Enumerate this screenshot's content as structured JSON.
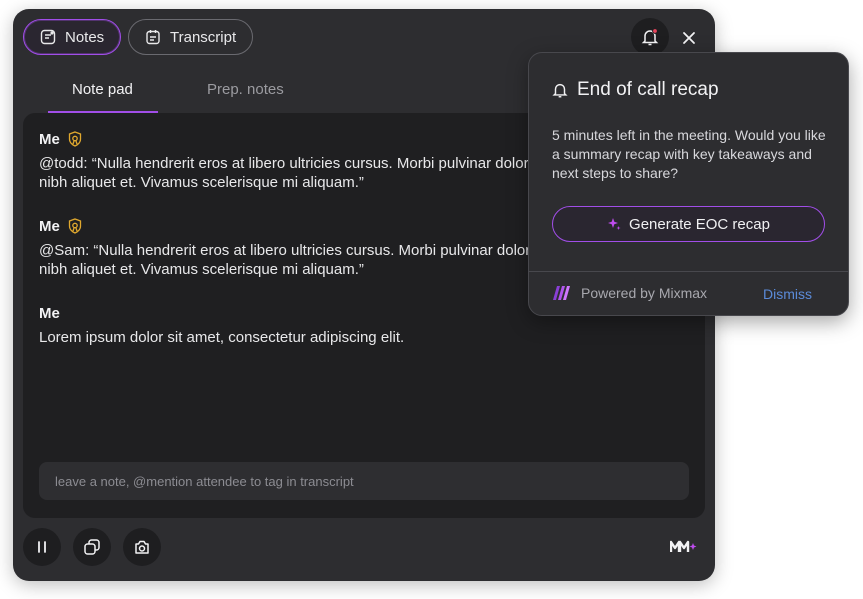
{
  "header": {
    "notes_label": "Notes",
    "transcript_label": "Transcript"
  },
  "tabs": [
    {
      "label": "Note pad",
      "active": true
    },
    {
      "label": "Prep. notes",
      "active": false
    }
  ],
  "notes": [
    {
      "author": "Me",
      "badge": true,
      "lines": [
        "@todd: “Nulla hendrerit eros at libero ultricies cursus. Morbi pulvinar dolor sapien, eu fringilla",
        "nibh aliquet et. Vivamus scelerisque mi aliquam.”"
      ]
    },
    {
      "author": "Me",
      "badge": true,
      "lines": [
        "@Sam: “Nulla hendrerit eros at libero ultricies cursus. Morbi pulvinar dolor sapien, eu fringilla",
        "nibh aliquet et. Vivamus scelerisque mi aliquam.”"
      ]
    },
    {
      "author": "Me",
      "badge": false,
      "lines": [
        "Lorem ipsum dolor sit amet, consectetur adipiscing elit."
      ]
    }
  ],
  "note_input": {
    "placeholder": "leave a note, @mention attendee to tag in transcript"
  },
  "popup": {
    "title": "End of call recap",
    "body": "5 minutes left in the meeting. Would you like a summary recap with key takeaways and next steps to share?",
    "button_label": "Generate EOC recap",
    "powered_by": "Powered by Mixmax",
    "dismiss_label": "Dismiss"
  },
  "colors": {
    "accent": "#a14ee8",
    "background": "#2d2d30",
    "panel": "#1f1f21",
    "link": "#5b8bd9",
    "badge": "#e0a82e"
  },
  "icons": [
    "notes-icon",
    "transcript-icon",
    "bell-icon",
    "close-icon",
    "shield-badge-icon",
    "pause-icon",
    "copy-icon",
    "camera-icon",
    "mixmax-logo-icon",
    "sparkle-icon"
  ]
}
